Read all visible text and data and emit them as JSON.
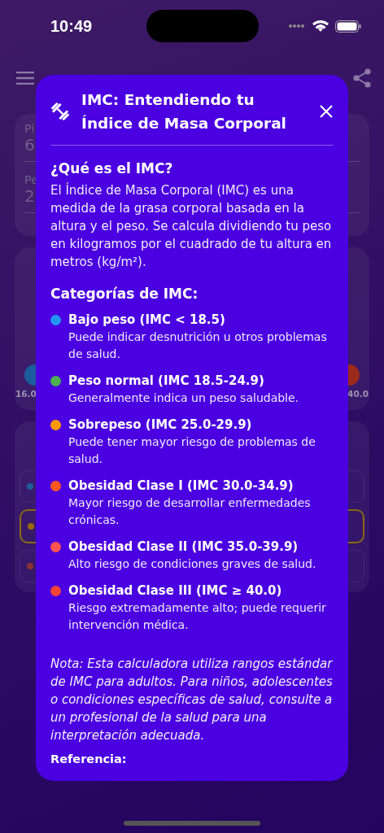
{
  "status_bar": {
    "time": "10:49"
  },
  "background": {
    "field_1": {
      "label": "Pi",
      "value": "6"
    },
    "field_2": {
      "label": "Pe",
      "value": "2"
    },
    "scale_min": "16.0",
    "scale_max": "40.0"
  },
  "dialog": {
    "title": "IMC: Entendiendo tu Índice de Masa Corporal",
    "intro_heading": "¿Qué es el IMC?",
    "intro_text": "El Índice de Masa Corporal (IMC) es una medida de la grasa corporal basada en la altura y el peso. Se calcula dividiendo tu peso en kilogramos por el cuadrado de tu altura en metros (kg/m²).",
    "categories_heading": "Categorías de IMC:",
    "categories": [
      {
        "name": "Bajo peso (IMC < 18.5)",
        "description": "Puede indicar desnutrición u otros problemas de salud.",
        "color": "#2196f3"
      },
      {
        "name": "Peso normal (IMC 18.5-24.9)",
        "description": "Generalmente indica un peso saludable.",
        "color": "#4caf50"
      },
      {
        "name": "Sobrepeso (IMC 25.0-29.9)",
        "description": "Puede tener mayor riesgo de problemas de salud.",
        "color": "#ff9800"
      },
      {
        "name": "Obesidad Clase I (IMC 30.0-34.9)",
        "description": "Mayor riesgo de desarrollar enfermedades crónicas.",
        "color": "#ff5722"
      },
      {
        "name": "Obesidad Clase II (IMC 35.0-39.9)",
        "description": "Alto riesgo de condiciones graves de salud.",
        "color": "#ff5252"
      },
      {
        "name": "Obesidad Clase III (IMC ≥ 40.0)",
        "description": "Riesgo extremadamente alto; puede requerir intervención médica.",
        "color": "#f44336"
      }
    ],
    "note": "Nota: Esta calculadora utiliza rangos estándar de IMC para adultos. Para niños, adolescentes o condiciones específicas de salud, consulte a un profesional de la salud para una interpretación adecuada.",
    "reference_heading": "Referencia:"
  }
}
